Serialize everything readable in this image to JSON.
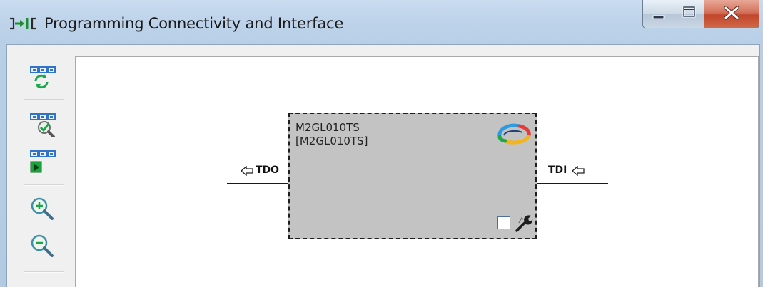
{
  "window": {
    "title": "Programming Connectivity and Interface"
  },
  "caption_buttons": [
    "minimize",
    "maximize",
    "close"
  ],
  "toolbar": {
    "buttons": [
      {
        "name": "refresh-chain",
        "icon": "chain-refresh-icon"
      },
      {
        "name": "verify-chain",
        "icon": "chain-check-icon"
      },
      {
        "name": "run-chain",
        "icon": "chain-run-icon"
      },
      {
        "name": "zoom-in",
        "icon": "zoom-in-icon"
      },
      {
        "name": "zoom-out",
        "icon": "zoom-out-icon"
      }
    ]
  },
  "device": {
    "name": "M2GL010TS",
    "id": "[M2GL010TS]",
    "checked": false
  },
  "pins": {
    "tdo": "TDO",
    "tdi": "TDI"
  },
  "colors": {
    "title_bar": "#bed3ea",
    "canvas": "#ffffff",
    "device_fill": "#c3c3c3",
    "close_button": "#c9533a",
    "chain_icon": "#2f74c8",
    "refresh_green": "#1aa64a",
    "run_green": "#18a33c"
  }
}
